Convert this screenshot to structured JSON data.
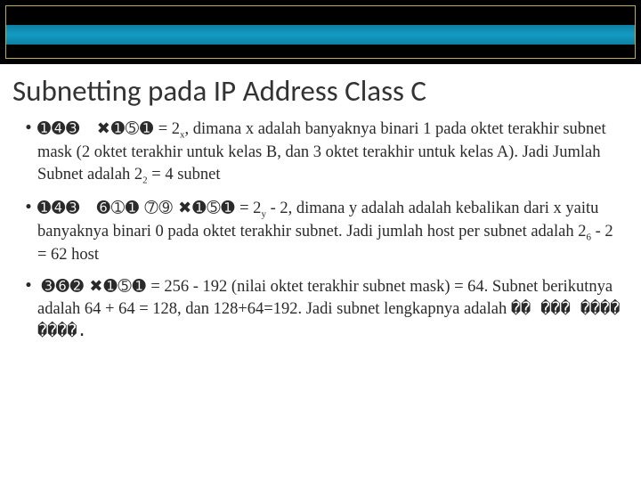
{
  "title": "Subnetting pada IP Address Class C",
  "bullets": [
    {
      "wing1": "➊➍➌",
      "wing2": "✖➊➄➊",
      "text1": " = 2",
      "sub1": "x",
      "text2": ", dimana x adalah banyaknya binari 1 pada oktet terakhir subnet mask (2 oktet terakhir untuk kelas B, dan 3 oktet terakhir untuk kelas A). Jadi Jumlah Subnet adalah 2",
      "sub2": "2",
      "text3": " = 4 subnet"
    },
    {
      "wing1": "➊➍➌",
      "wing2": "➏➀➊   ➆➈   ✖➊➄➊",
      "text1": " = 2",
      "sub1": "y",
      "text2": " - 2, dimana y adalah adalah kebalikan dari x yaitu banyaknya binari 0 pada oktet terakhir subnet. Jadi jumlah host per subnet adalah 2",
      "sub2": "6",
      "text3": " - 2 = 62 host"
    },
    {
      "wing1": "➌➏➋   ✖➊➄➊",
      "wing2": "",
      "text1": " = 256 - 192 (nilai oktet terakhir subnet mask) = 64. Subnet berikutnya adalah 64 + 64 = 128, dan 128+64=192. Jadi subnet lengkapnya  adalah ",
      "sub1": "",
      "text2": "",
      "sub2": "",
      "text3": "��  ���  ����  ����."
    }
  ]
}
